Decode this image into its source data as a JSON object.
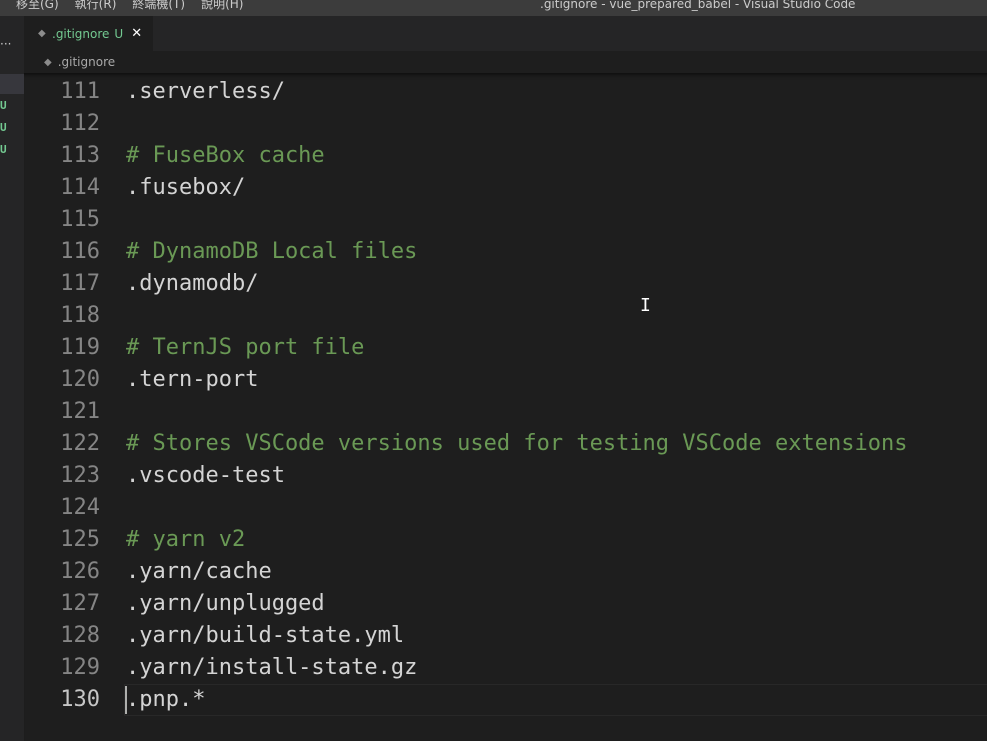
{
  "titlebar": {
    "menu": [
      "移至(G)",
      "執行(R)",
      "終端機(T)",
      "說明(H)"
    ],
    "title": ".gitignore - vue_prepared_babel - Visual Studio Code"
  },
  "sidebar": {
    "more": "···",
    "badges": [
      "U",
      "U",
      "U"
    ]
  },
  "tab": {
    "name": ".gitignore",
    "status": "U",
    "close": "✕"
  },
  "breadcrumb": {
    "file": ".gitignore"
  },
  "editor": {
    "lines": [
      {
        "n": "111",
        "text": ".serverless/",
        "comment": false
      },
      {
        "n": "112",
        "text": "",
        "comment": false
      },
      {
        "n": "113",
        "text": "# FuseBox cache",
        "comment": true
      },
      {
        "n": "114",
        "text": ".fusebox/",
        "comment": false
      },
      {
        "n": "115",
        "text": "",
        "comment": false
      },
      {
        "n": "116",
        "text": "# DynamoDB Local files",
        "comment": true
      },
      {
        "n": "117",
        "text": ".dynamodb/",
        "comment": false
      },
      {
        "n": "118",
        "text": "",
        "comment": false
      },
      {
        "n": "119",
        "text": "# TernJS port file",
        "comment": true
      },
      {
        "n": "120",
        "text": ".tern-port",
        "comment": false
      },
      {
        "n": "121",
        "text": "",
        "comment": false
      },
      {
        "n": "122",
        "text": "# Stores VSCode versions used for testing VSCode extensions",
        "comment": true
      },
      {
        "n": "123",
        "text": ".vscode-test",
        "comment": false
      },
      {
        "n": "124",
        "text": "",
        "comment": false
      },
      {
        "n": "125",
        "text": "# yarn v2",
        "comment": true
      },
      {
        "n": "126",
        "text": ".yarn/cache",
        "comment": false
      },
      {
        "n": "127",
        "text": ".yarn/unplugged",
        "comment": false
      },
      {
        "n": "128",
        "text": ".yarn/build-state.yml",
        "comment": false
      },
      {
        "n": "129",
        "text": ".yarn/install-state.gz",
        "comment": false
      },
      {
        "n": "130",
        "text": ".pnp.*",
        "comment": false
      }
    ]
  },
  "icons": {
    "file_icon": "◆",
    "ibeam": "I"
  },
  "colors": {
    "background": "#1e1e1e",
    "comment": "#6a9955",
    "untracked": "#73c991",
    "line_number": "#858585"
  }
}
